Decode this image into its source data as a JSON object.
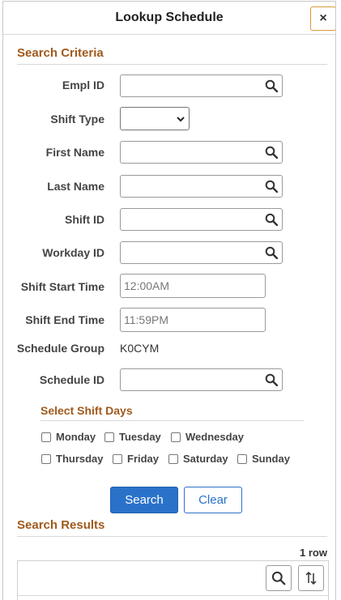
{
  "dialog": {
    "title": "Lookup Schedule",
    "close_glyph": "×"
  },
  "search_criteria": {
    "heading": "Search Criteria",
    "fields": {
      "empl_id": {
        "label": "Empl ID",
        "value": ""
      },
      "shift_type": {
        "label": "Shift Type",
        "value": ""
      },
      "first_name": {
        "label": "First Name",
        "value": ""
      },
      "last_name": {
        "label": "Last Name",
        "value": ""
      },
      "shift_id": {
        "label": "Shift ID",
        "value": ""
      },
      "workday_id": {
        "label": "Workday ID",
        "value": ""
      },
      "shift_start_time": {
        "label": "Shift Start Time",
        "placeholder": "12:00AM"
      },
      "shift_end_time": {
        "label": "Shift End Time",
        "placeholder": "11:59PM"
      },
      "schedule_group": {
        "label": "Schedule Group",
        "value": "K0CYM"
      },
      "schedule_id": {
        "label": "Schedule ID",
        "value": ""
      }
    },
    "shift_days": {
      "heading": "Select Shift Days",
      "days": [
        "Monday",
        "Tuesday",
        "Wednesday",
        "Thursday",
        "Friday",
        "Saturday",
        "Sunday"
      ]
    },
    "buttons": {
      "search": "Search",
      "clear": "Clear"
    }
  },
  "search_results": {
    "heading": "Search Results",
    "row_count": "1 row"
  },
  "icons": [
    "close-icon",
    "search-icon",
    "chevron-down-icon",
    "sort-icon"
  ],
  "colors": {
    "section_heading": "#a05a1c",
    "primary_button": "#2a72c9",
    "close_border": "#d89a3a"
  }
}
